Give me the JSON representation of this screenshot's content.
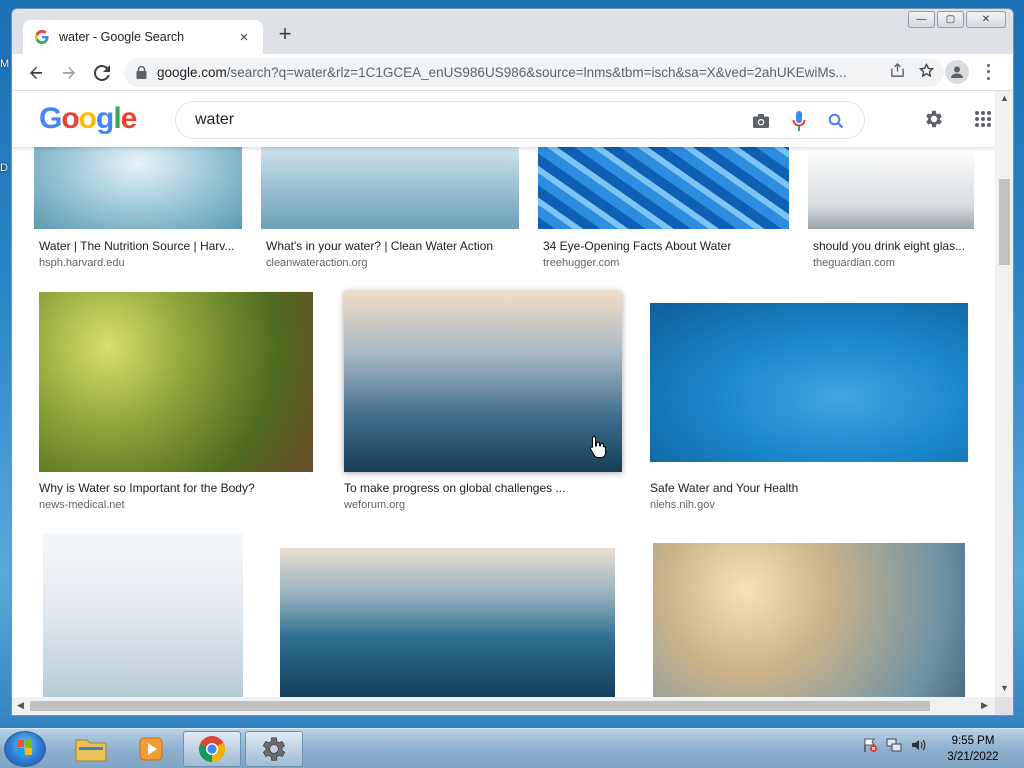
{
  "desktop": {
    "frag_top": "M",
    "frag_bottom": "D"
  },
  "window": {
    "minimize": "—",
    "maximize": "▢",
    "close": "✕"
  },
  "tab": {
    "title": "water - Google Search",
    "close": "×",
    "new_tab": "+"
  },
  "toolbar": {
    "url_host": "google.com",
    "url_path": "/search?q=water&rlz=1C1GCEA_enUS986US986&source=lnms&tbm=isch&sa=X&ved=2ahUKEwiMs..."
  },
  "google": {
    "logo": [
      "G",
      "o",
      "o",
      "g",
      "l",
      "e"
    ],
    "logo_colors": [
      "#4285f4",
      "#ea4335",
      "#fbbc05",
      "#4285f4",
      "#34a853",
      "#ea4335"
    ],
    "query": "water"
  },
  "results": [
    {
      "title": "Water | The Nutrition Source | Harv...",
      "domain": "hsph.harvard.edu"
    },
    {
      "title": "What's in your water? | Clean Water Action",
      "domain": "cleanwateraction.org"
    },
    {
      "title": "34 Eye-Opening Facts About Water",
      "domain": "treehugger.com"
    },
    {
      "title": "should you drink eight glas...",
      "domain": "theguardian.com"
    },
    {
      "title": "Why is Water so Important for the Body?",
      "domain": "news-medical.net"
    },
    {
      "title": "To make progress on global challenges ...",
      "domain": "weforum.org"
    },
    {
      "title": "Safe Water and Your Health",
      "domain": "niehs.nih.gov"
    }
  ],
  "clock": {
    "time": "9:55 PM",
    "date": "3/21/2022"
  }
}
